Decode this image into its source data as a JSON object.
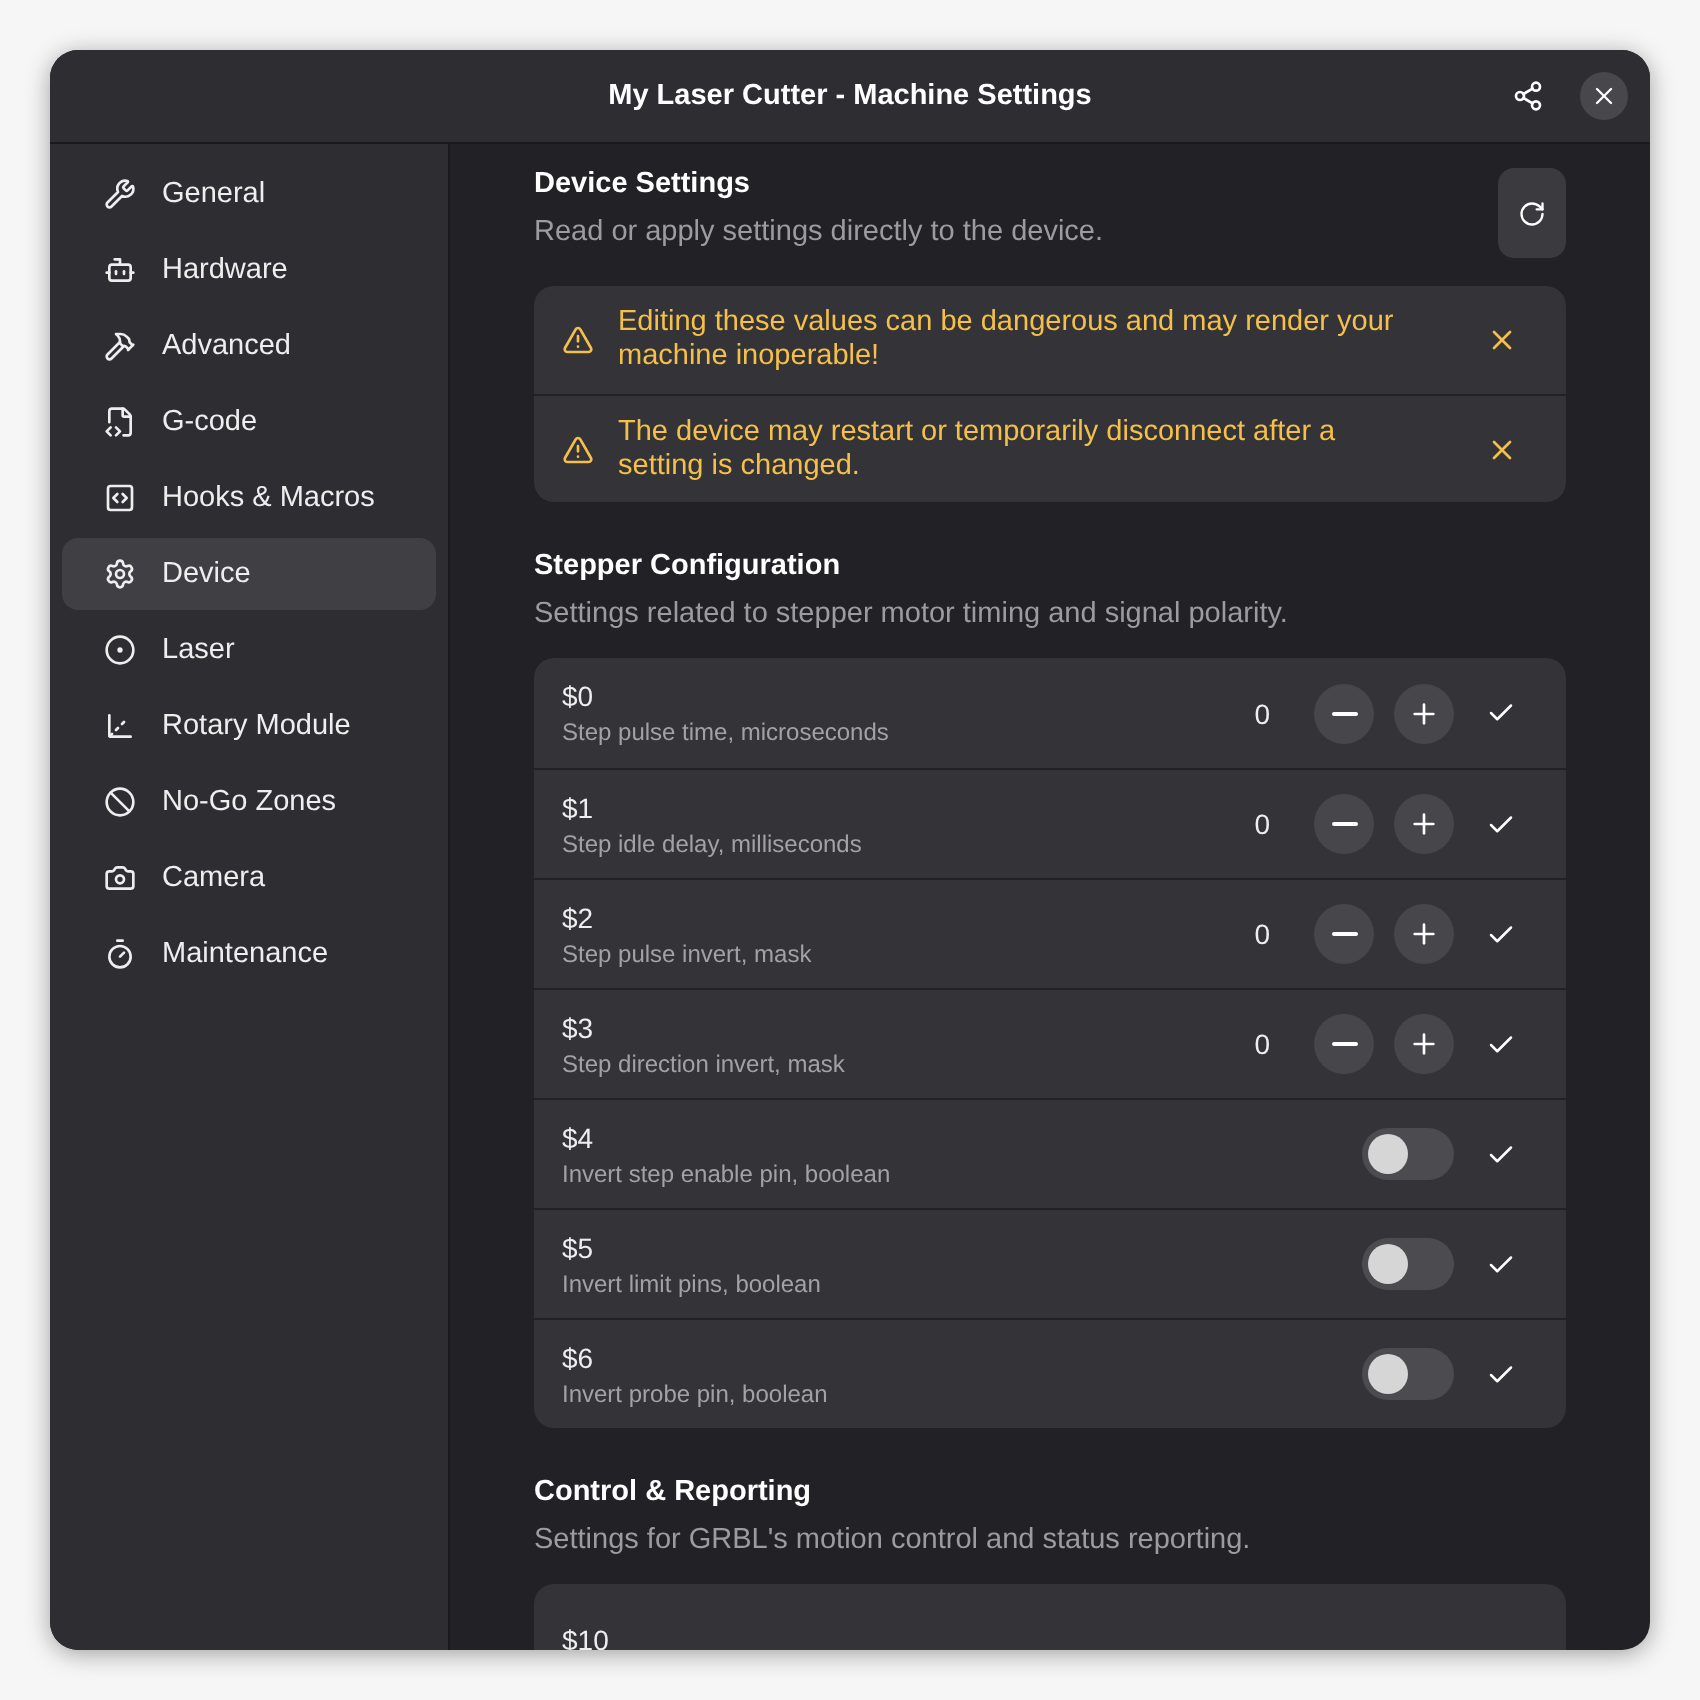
{
  "window": {
    "title": "My Laser Cutter - Machine Settings"
  },
  "sidebar": {
    "items": [
      {
        "label": "General",
        "selected": false
      },
      {
        "label": "Hardware",
        "selected": false
      },
      {
        "label": "Advanced",
        "selected": false
      },
      {
        "label": "G-code",
        "selected": false
      },
      {
        "label": "Hooks & Macros",
        "selected": false
      },
      {
        "label": "Device",
        "selected": true
      },
      {
        "label": "Laser",
        "selected": false
      },
      {
        "label": "Rotary Module",
        "selected": false
      },
      {
        "label": "No-Go Zones",
        "selected": false
      },
      {
        "label": "Camera",
        "selected": false
      },
      {
        "label": "Maintenance",
        "selected": false
      }
    ]
  },
  "sections": [
    {
      "kind": "device",
      "title": "Device Settings",
      "subtitle": "Read or apply settings directly to the device.",
      "warnings": [
        "Editing these values can be dangerous and may render your machine inoperable!",
        "The device may restart or temporarily disconnect after a setting is changed."
      ]
    },
    {
      "kind": "group",
      "title": "Stepper Configuration",
      "subtitle": "Settings related to stepper motor timing and signal polarity.",
      "rows": [
        {
          "kind": "number",
          "name": "$0",
          "description": "Step pulse time, microseconds",
          "value": "0"
        },
        {
          "kind": "number",
          "name": "$1",
          "description": "Step idle delay, milliseconds",
          "value": "0"
        },
        {
          "kind": "number",
          "name": "$2",
          "description": "Step pulse invert, mask",
          "value": "0"
        },
        {
          "kind": "number",
          "name": "$3",
          "description": "Step direction invert, mask",
          "value": "0"
        },
        {
          "kind": "switch",
          "name": "$4",
          "description": "Invert step enable pin, boolean",
          "on": false
        },
        {
          "kind": "switch",
          "name": "$5",
          "description": "Invert limit pins, boolean",
          "on": false
        },
        {
          "kind": "switch",
          "name": "$6",
          "description": "Invert probe pin, boolean",
          "on": false
        }
      ]
    },
    {
      "kind": "group",
      "title": "Control & Reporting",
      "subtitle": "Settings for GRBL's motion control and status reporting.",
      "rows": [
        {
          "kind": "partial",
          "name": "$10"
        }
      ]
    }
  ]
}
